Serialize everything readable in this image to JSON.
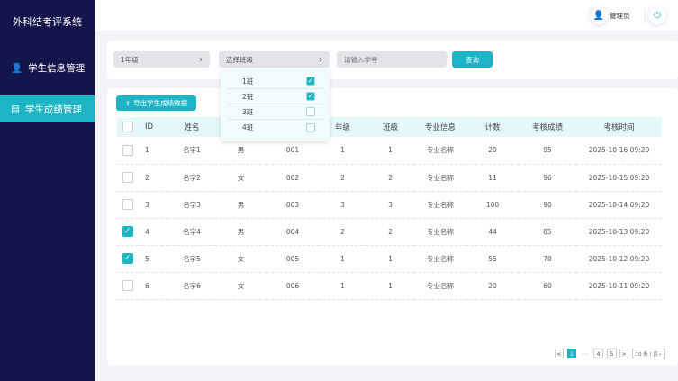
{
  "app": {
    "title": "外科结考评系统"
  },
  "sidebar": {
    "items": [
      {
        "label": "学生信息管理",
        "icon": "user-key-icon",
        "active": false
      },
      {
        "label": "学生成绩管理",
        "icon": "clipboard-icon",
        "active": true
      }
    ]
  },
  "header": {
    "user": "管理员"
  },
  "filters": {
    "grade": "1年级",
    "class_placeholder": "选择班级",
    "student_id_placeholder": "请输入学号",
    "search": "查询"
  },
  "class_dropdown": [
    {
      "label": "1班",
      "checked": true
    },
    {
      "label": "2班",
      "checked": true
    },
    {
      "label": "3班",
      "checked": false
    },
    {
      "label": "4班",
      "checked": false
    }
  ],
  "toolbar": {
    "export": "导出学生成绩数据"
  },
  "table": {
    "headers": [
      "ID",
      "姓名",
      "",
      "",
      "年级",
      "班级",
      "专业信息",
      "计数",
      "考核成绩",
      "考核时间"
    ],
    "rows": [
      {
        "checked": false,
        "cells": [
          "1",
          "名字1",
          "男",
          "001",
          "1",
          "1",
          "专业名称",
          "20",
          "95",
          "2025-10-16 09:20"
        ]
      },
      {
        "checked": false,
        "cells": [
          "2",
          "名字2",
          "女",
          "002",
          "2",
          "2",
          "专业名称",
          "11",
          "96",
          "2025-10-15 09:20"
        ]
      },
      {
        "checked": false,
        "cells": [
          "3",
          "名字3",
          "男",
          "003",
          "3",
          "3",
          "专业名称",
          "100",
          "90",
          "2025-10-14 09:20"
        ]
      },
      {
        "checked": true,
        "cells": [
          "4",
          "名字4",
          "男",
          "004",
          "2",
          "2",
          "专业名称",
          "44",
          "85",
          "2025-10-13 09:20"
        ]
      },
      {
        "checked": true,
        "cells": [
          "5",
          "名字5",
          "女",
          "005",
          "1",
          "1",
          "专业名称",
          "55",
          "70",
          "2025-10-12 09:20"
        ]
      },
      {
        "checked": false,
        "cells": [
          "6",
          "名字6",
          "女",
          "006",
          "1",
          "1",
          "专业名称",
          "20",
          "60",
          "2025-10-11 09:20"
        ]
      }
    ]
  },
  "pagination": {
    "prev": "<",
    "pages": [
      "1",
      "···",
      "4",
      "5"
    ],
    "current": "1",
    "next": ">",
    "page_size": "10 条 / 页"
  },
  "colors": {
    "sidebar": "#14154a",
    "accent": "#1cb5c5"
  }
}
